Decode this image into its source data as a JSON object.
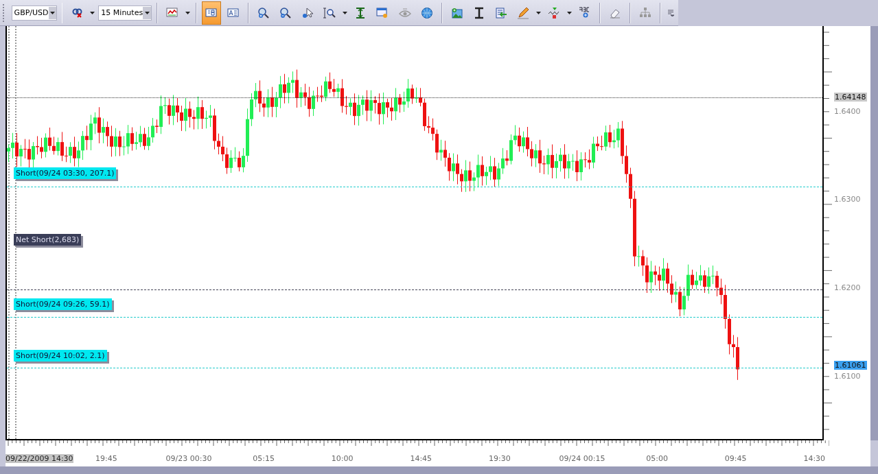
{
  "toolbar": {
    "symbol": "GBP/USD",
    "timeframe": "15 Minutes",
    "tool_buttons": [
      {
        "selected": false
      },
      {
        "selected": false
      },
      {
        "selected": true
      },
      {
        "selected": false
      },
      {
        "selected": false
      },
      {
        "selected": false
      },
      {
        "selected": false
      },
      {
        "selected": false
      },
      {
        "selected": false
      },
      {
        "selected": false
      },
      {
        "selected": false
      },
      {
        "selected": false
      },
      {
        "selected": false
      },
      {
        "selected": false
      },
      {
        "selected": false
      },
      {
        "selected": false
      },
      {
        "selected": false
      },
      {
        "selected": false
      },
      {
        "selected": false
      },
      {
        "selected": false
      }
    ]
  },
  "price_axis": {
    "labels": [
      "1.6400",
      "1.6300",
      "1.6200",
      "1.6100"
    ],
    "markers": [
      {
        "kind": "last-line",
        "text": "1.64148"
      },
      {
        "kind": "current",
        "text": "1.61061"
      }
    ]
  },
  "time_axis": {
    "labels": [
      {
        "text": "09/22/2009 14:30",
        "selected": true
      },
      {
        "text": "19:45",
        "selected": false
      },
      {
        "text": "09/23 00:30",
        "selected": false
      },
      {
        "text": "05:15",
        "selected": false
      },
      {
        "text": "10:00",
        "selected": false
      },
      {
        "text": "14:45",
        "selected": false
      },
      {
        "text": "19:30",
        "selected": false
      },
      {
        "text": "09/24 00:15",
        "selected": false
      },
      {
        "text": "05:00",
        "selected": false
      },
      {
        "text": "09:45",
        "selected": false
      },
      {
        "text": "14:30",
        "selected": false
      }
    ]
  },
  "positions": [
    {
      "kind": "short",
      "text": "Short(09/24 03:30, 207.1)"
    },
    {
      "kind": "net",
      "text": "Net Short(2,683)"
    },
    {
      "kind": "short",
      "text": "Short(09/24 09:26, 59.1)"
    },
    {
      "kind": "short",
      "text": "Short(09/24 10:02, 2.1)"
    }
  ]
}
